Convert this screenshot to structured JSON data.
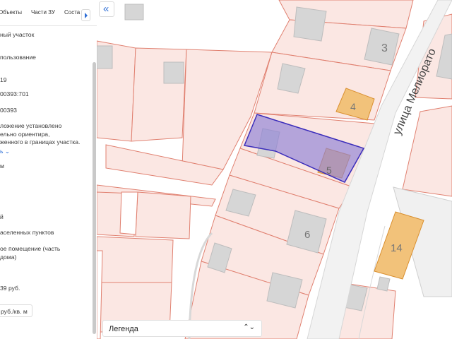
{
  "panel": {
    "tabs": [
      "Объекты",
      "Части ЗУ",
      "Соста"
    ],
    "rows": [
      {
        "text": "ный участок",
        "link": false
      },
      {
        "text": "пользование",
        "link": false
      },
      {
        "text": "19",
        "link": false
      },
      {
        "text": "00393:701",
        "link": false
      },
      {
        "text": "00393",
        "link": false
      },
      {
        "text": "ложение установлено",
        "link": false
      },
      {
        "text": "ельно ориентира,",
        "link": false
      },
      {
        "text": "женного в границах участка.",
        "link": false
      },
      {
        "text": "ь ⌄",
        "link": true
      },
      {
        "text": "м",
        "link": false
      },
      {
        "text": "й",
        "link": false
      },
      {
        "text": "аселенных пунктов",
        "link": false
      },
      {
        "text": "ое помещение (часть",
        "link": false
      },
      {
        "text": "дома)",
        "link": false
      },
      {
        "text": "39 руб.",
        "link": false
      }
    ],
    "price_per_m2": "руб./кв. м"
  },
  "map": {
    "collapse_icon": "«",
    "street": "улица Мелиорато",
    "house_numbers": [
      "3",
      "4",
      "5",
      "6",
      "14"
    ],
    "legend": "Легенда",
    "legend_icon": "⌃⌄",
    "colors": {
      "parcel_border": "#e08070",
      "parcel_fill": "#fbe7e3",
      "building": "#d3d3d3",
      "house": "#f2c27a",
      "selected": "#8e7fd6",
      "road": "#d6d6d6"
    }
  }
}
